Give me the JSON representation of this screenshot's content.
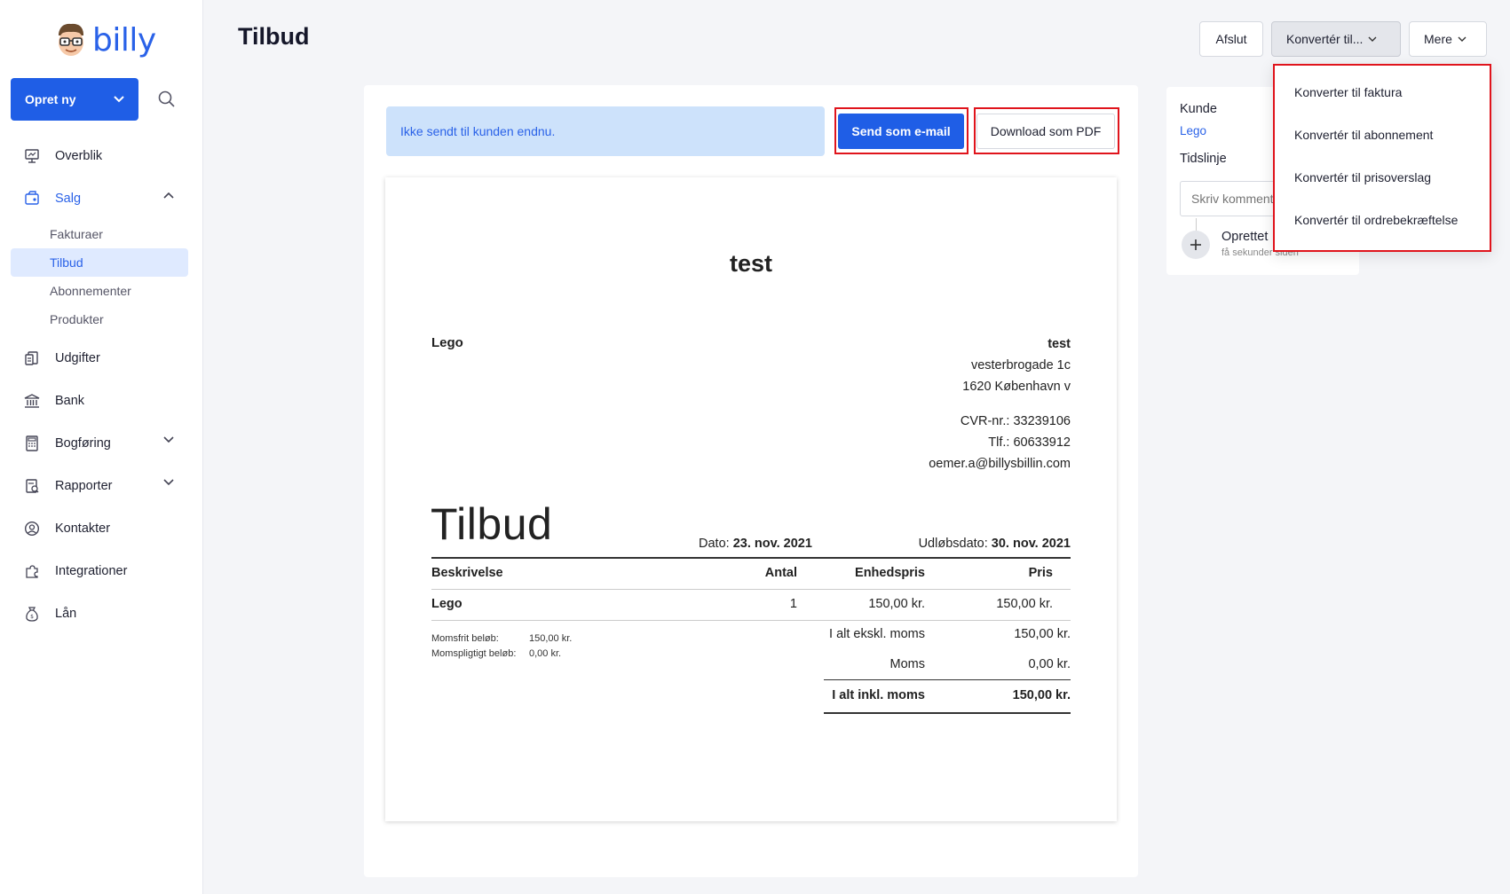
{
  "app": {
    "name": "billy"
  },
  "sidebar": {
    "create_label": "Opret ny",
    "items": [
      {
        "label": "Overblik",
        "icon": "dashboard-icon"
      },
      {
        "label": "Salg",
        "icon": "sales-icon"
      },
      {
        "label": "Udgifter",
        "icon": "expenses-icon"
      },
      {
        "label": "Bank",
        "icon": "bank-icon"
      },
      {
        "label": "Bogføring",
        "icon": "bookkeeping-icon"
      },
      {
        "label": "Rapporter",
        "icon": "reports-icon"
      },
      {
        "label": "Kontakter",
        "icon": "contacts-icon"
      },
      {
        "label": "Integrationer",
        "icon": "integrations-icon"
      },
      {
        "label": "Lån",
        "icon": "loan-icon"
      }
    ],
    "sales_sub": [
      {
        "label": "Fakturaer"
      },
      {
        "label": "Tilbud"
      },
      {
        "label": "Abonnementer"
      },
      {
        "label": "Produkter"
      }
    ]
  },
  "header": {
    "title": "Tilbud",
    "close_label": "Afslut",
    "convert_label": "Konvertér til...",
    "more_label": "Mere"
  },
  "convert_menu": {
    "options": [
      {
        "label": "Konverter til faktura"
      },
      {
        "label": "Konvertér til abonnement"
      },
      {
        "label": "Konvertér til prisoverslag"
      },
      {
        "label": "Konvertér til ordrebekræftelse"
      }
    ]
  },
  "actions": {
    "notice": "Ikke sendt til kunden endnu.",
    "send_email_label": "Send som e-mail",
    "download_pdf_label": "Download som PDF"
  },
  "document": {
    "title": "test",
    "customer": "Lego",
    "sender": {
      "name": "test",
      "street": "vesterbrogade 1c",
      "city": "1620 København v",
      "cvr": "CVR-nr.: 33239106",
      "phone": "Tlf.: 60633912",
      "email": "oemer.a@billysbillin.com"
    },
    "heading": "Tilbud",
    "date_label": "Dato:",
    "date_value": "23. nov. 2021",
    "expiry_label": "Udløbsdato:",
    "expiry_value": "30. nov. 2021",
    "table": {
      "headers": [
        "Beskrivelse",
        "Antal",
        "Enhedspris",
        "Pris"
      ],
      "rows": [
        {
          "description": "Lego",
          "qty": "1",
          "unit_price": "150,00 kr.",
          "price": "150,00 kr."
        }
      ]
    },
    "vat_free_label": "Momsfrit beløb:",
    "vat_free_value": "150,00 kr.",
    "vat_liable_label": "Momspligtigt beløb:",
    "vat_liable_value": "0,00 kr.",
    "totals": {
      "excl_label": "I alt ekskl. moms",
      "excl_value": "150,00 kr.",
      "vat_label": "Moms",
      "vat_value": "0,00 kr.",
      "incl_label": "I alt inkl. moms",
      "incl_value": "150,00 kr."
    }
  },
  "right_panel": {
    "customer_label": "Kunde",
    "customer_link": "Lego",
    "timeline_label": "Tidslinje",
    "comment_placeholder": "Skriv kommentar",
    "event_title": "Oprettet",
    "event_time": "få sekunder siden"
  },
  "colors": {
    "accent": "#1f5ee6",
    "highlight": "#e0141c",
    "notice_bg": "#cde2fb",
    "active_nav_bg": "#dfeaff"
  }
}
